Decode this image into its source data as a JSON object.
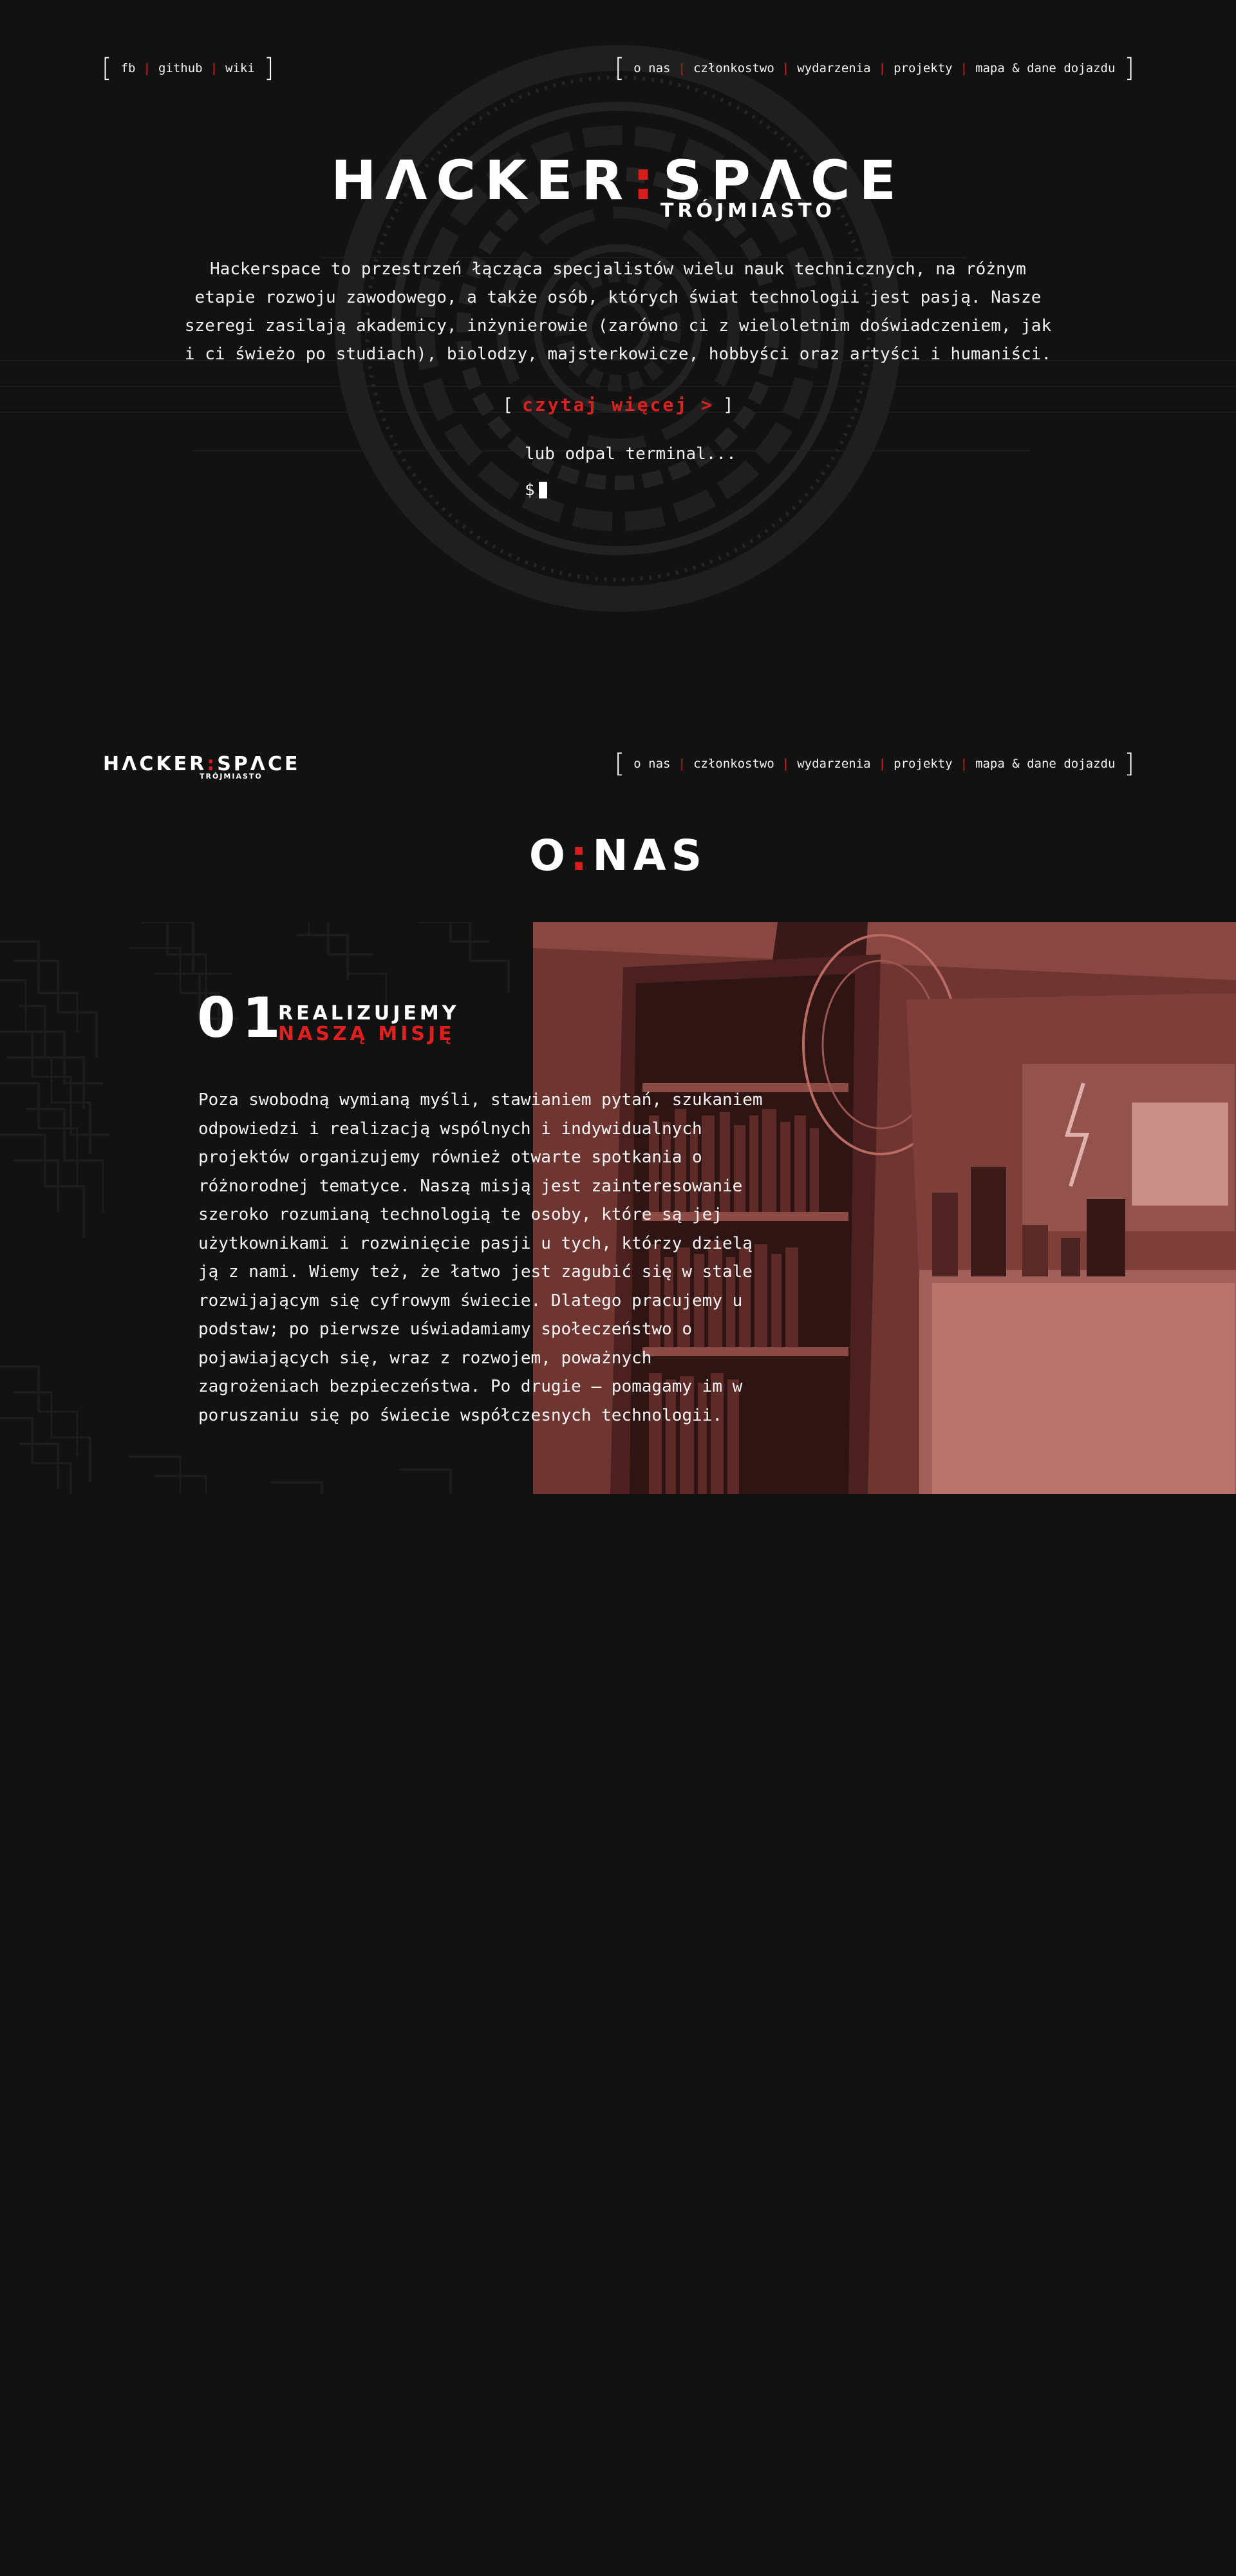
{
  "top_nav_left": {
    "items": [
      "fb",
      "github",
      "wiki"
    ]
  },
  "main_nav": {
    "items": [
      "o nas",
      "członkostwo",
      "wydarzenia",
      "projekty",
      "mapa & dane dojazdu"
    ]
  },
  "logo": {
    "word_left": "HΛCKER",
    "colon": ":",
    "word_right": "SPΛCE",
    "subtitle": "TRÓJMIASTO"
  },
  "hero": {
    "intro": "Hackerspace to przestrzeń łącząca specjalistów wielu nauk technicznych, na różnym etapie rozwoju zawodowego, a także osób, których świat technologii jest pasją. Nasze szeregi zasilają akademicy, inżynierowie (zarówno ci z wieloletnim doświadczeniem, jak i ci świeżo po studiach), biolodzy, majsterkowicze, hobbyści oraz artyści i humaniści.",
    "read_more_open": "[",
    "read_more_label": "czytaj więcej",
    "read_more_arrow": ">",
    "read_more_close": "]",
    "terminal_hint": "lub odpal terminal...",
    "terminal_prompt": "$"
  },
  "about": {
    "title_left": "O",
    "title_colon": ":",
    "title_right": "NAS",
    "mission_number": "01",
    "mission_line1": "REALIZUJEMY",
    "mission_line2": "NASZĄ MISJĘ",
    "mission_text": "Poza swobodną wymianą myśli, stawianiem pytań, szukaniem odpowiedzi i realizacją wspólnych i indywidualnych projektów organizujemy również otwarte spotkania o różnorodnej tematyce. Naszą misją jest zainteresowanie szeroko rozumianą technologią te osoby, które są jej użytkownikami i rozwinięcie pasji u tych, którzy dzielą ją z nami. Wiemy też, że łatwo jest zagubić się w stale rozwijającym się cyfrowym świecie. Dlatego pracujemy u podstaw; po pierwsze uświadamiamy społeczeństwo o pojawiających się, wraz z rozwojem, poważnych zagrożeniach bezpieczeństwa. Po drugie — pomagamy im w poruszaniu się po świecie współczesnych technologii."
  },
  "colors": {
    "background": "#121212",
    "accent": "#d51f1f",
    "text": "#ffffff",
    "photo_tint": "#7a3a36"
  },
  "icons": {
    "cursor": "terminal-cursor-icon",
    "bracket": "bracket-icon"
  }
}
